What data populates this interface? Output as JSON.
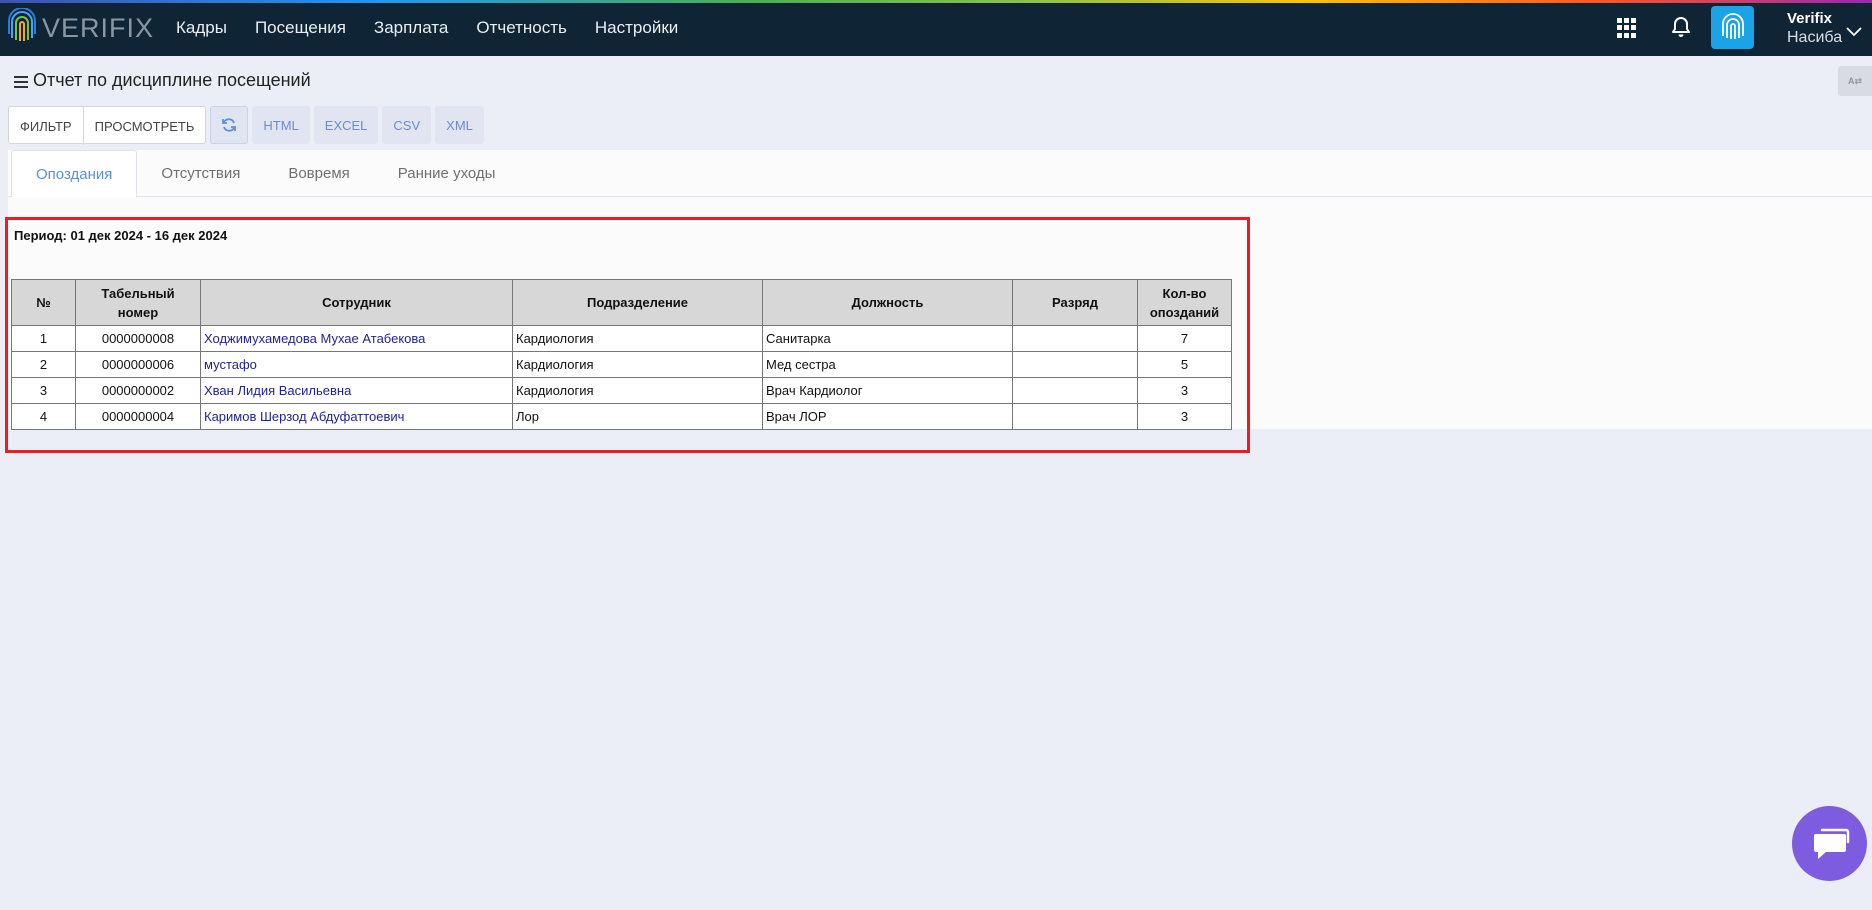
{
  "header": {
    "logo_text": "VERIFIX",
    "nav": [
      "Кадры",
      "Посещения",
      "Зарплата",
      "Отчетность",
      "Настройки"
    ],
    "user": {
      "name": "Verifix",
      "sub": "Насиба"
    }
  },
  "page": {
    "title": "Отчет по дисциплине посещений"
  },
  "toolbar": {
    "filter_label": "ФИЛЬТР",
    "view_label": "ПРОСМОТРЕТЬ",
    "formats": [
      "HTML",
      "EXCEL",
      "CSV",
      "XML"
    ]
  },
  "tabs": [
    {
      "label": "Опоздания",
      "active": true
    },
    {
      "label": "Отсутствия",
      "active": false
    },
    {
      "label": "Вовремя",
      "active": false
    },
    {
      "label": "Ранние уходы",
      "active": false
    }
  ],
  "report": {
    "period": "Период: 01 дек 2024 - 16 дек 2024",
    "columns": [
      "№",
      "Табельный номер",
      "Сотрудник",
      "Подразделение",
      "Должность",
      "Разряд",
      "Кол-во опозданий"
    ],
    "rows": [
      {
        "n": "1",
        "tab": "0000000008",
        "employee": "Ходжимухамедова Мухае Атабекова",
        "division": "Кардиология",
        "position": "Санитарка",
        "grade": "",
        "count": "7"
      },
      {
        "n": "2",
        "tab": "0000000006",
        "employee": "мустафо",
        "division": "Кардиология",
        "position": "Мед сестра",
        "grade": "",
        "count": "5"
      },
      {
        "n": "3",
        "tab": "0000000002",
        "employee": "Хван Лидия Васильевна",
        "division": "Кардиология",
        "position": "Врач Кардиолог",
        "grade": "",
        "count": "3"
      },
      {
        "n": "4",
        "tab": "0000000004",
        "employee": "Каримов Шерзод Абдуфаттоевич",
        "division": "Лор",
        "position": "Врач ЛОР",
        "grade": "",
        "count": "3"
      }
    ]
  },
  "colors": {
    "topbar": "#0f2535",
    "accent": "#5f8fd6",
    "highlight": "#ec1c24",
    "chat": "#7e5ce0"
  }
}
